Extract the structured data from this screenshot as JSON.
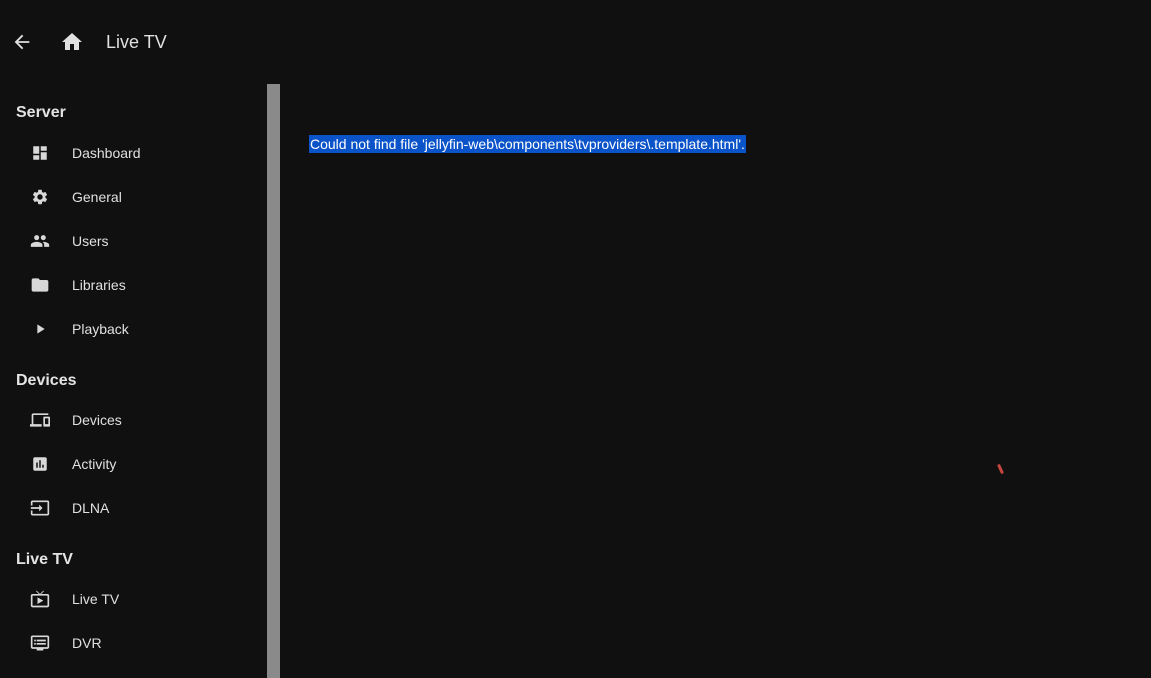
{
  "header": {
    "title": "Live TV",
    "back_icon": "arrow-left-icon",
    "home_icon": "home-icon"
  },
  "sidebar": {
    "sections": [
      {
        "title": "Server",
        "items": [
          {
            "label": "Dashboard",
            "icon": "dashboard-icon"
          },
          {
            "label": "General",
            "icon": "gear-icon"
          },
          {
            "label": "Users",
            "icon": "people-icon"
          },
          {
            "label": "Libraries",
            "icon": "folder-icon"
          },
          {
            "label": "Playback",
            "icon": "play-icon"
          }
        ]
      },
      {
        "title": "Devices",
        "items": [
          {
            "label": "Devices",
            "icon": "devices-icon"
          },
          {
            "label": "Activity",
            "icon": "activity-chart-icon"
          },
          {
            "label": "DLNA",
            "icon": "input-icon"
          }
        ]
      },
      {
        "title": "Live TV",
        "items": [
          {
            "label": "Live TV",
            "icon": "live-tv-icon"
          },
          {
            "label": "DVR",
            "icon": "dvr-icon"
          }
        ]
      }
    ]
  },
  "main": {
    "error_message": "Could not find file 'jellyfin-web\\components\\tvproviders\\.template.html'."
  },
  "colors": {
    "background": "#101010",
    "selection": "#0a53c9",
    "scrollbar": "#8a8a8a",
    "text": "#e0e0e0"
  }
}
